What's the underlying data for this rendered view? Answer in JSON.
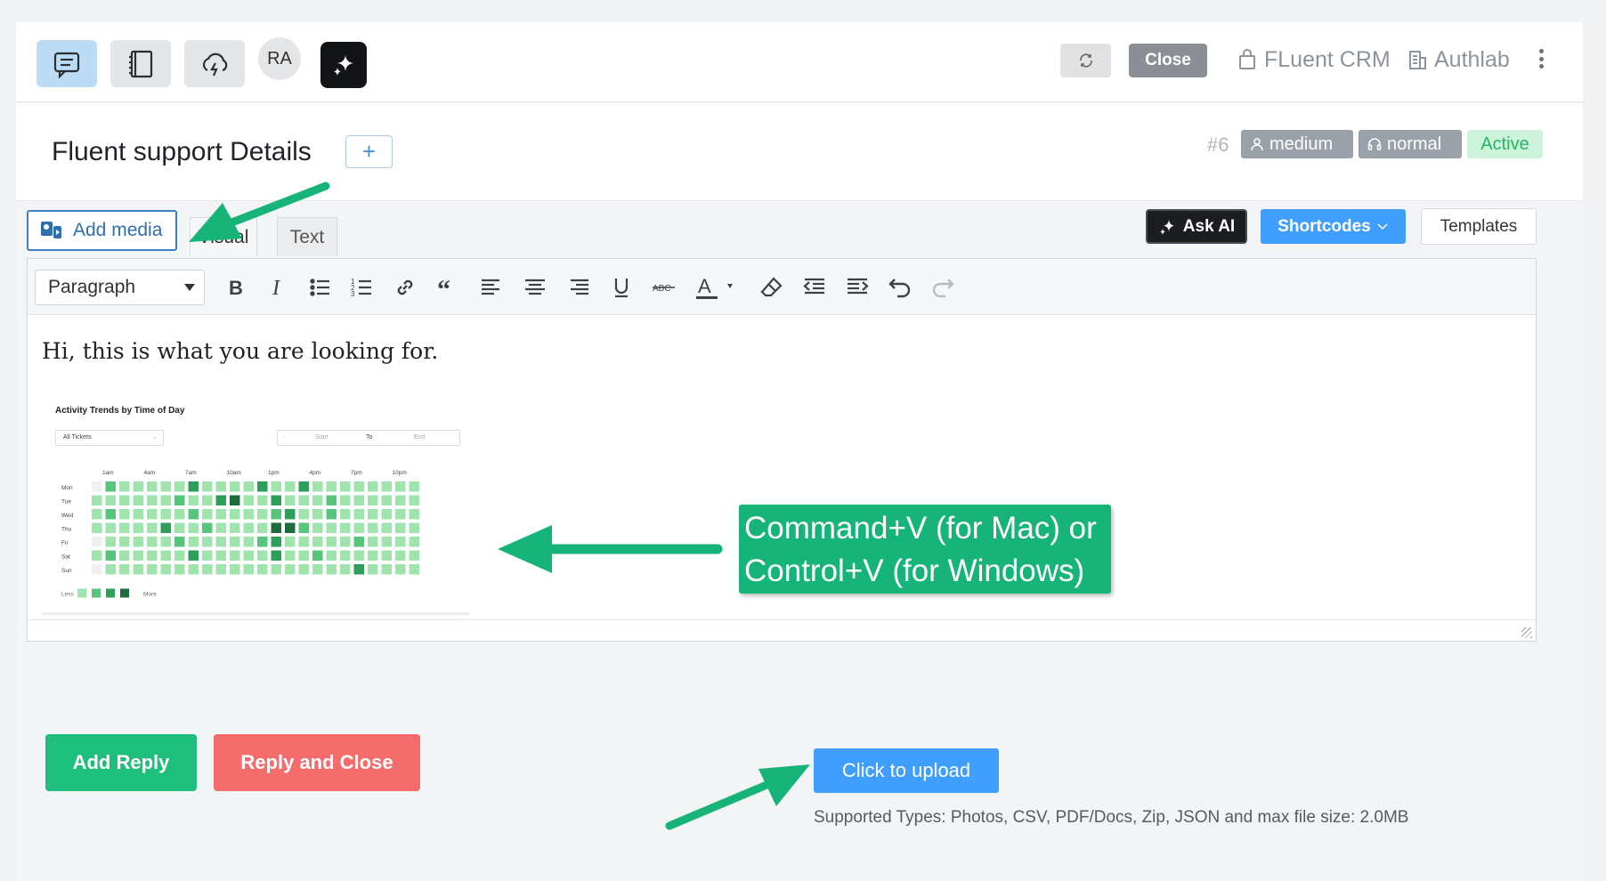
{
  "topbar": {
    "avatar_initials": "RA",
    "close_label": "Close",
    "crm_label": "FLuent CRM",
    "auth_label": "Authlab"
  },
  "header": {
    "title": "Fluent support Details",
    "add_label": "+",
    "ticket_id": "#6",
    "priority_badge": "medium",
    "client_priority_badge": "normal",
    "status_badge": "Active"
  },
  "editor": {
    "add_media_label": "Add media",
    "tab_visual": "Visual",
    "tab_text": "Text",
    "ask_ai_label": "Ask AI",
    "shortcodes_label": "Shortcodes",
    "templates_label": "Templates",
    "format_select": "Paragraph",
    "toolbar_icons": [
      "bold-icon",
      "italic-icon",
      "bullet-list-icon",
      "numbered-list-icon",
      "link-icon",
      "blockquote-icon",
      "align-left-icon",
      "align-center-icon",
      "align-right-icon",
      "underline-icon",
      "strikethrough-icon",
      "text-color-icon",
      "clear-formatting-icon",
      "outdent-icon",
      "indent-icon",
      "undo-icon",
      "redo-icon"
    ],
    "content_text": "Hi, this is what you are looking for."
  },
  "pasted_image": {
    "title": "Activity Trends by Time of Day",
    "filter_value": "All Tickets",
    "date_start": "Start",
    "date_to": "To",
    "date_end": "End",
    "hour_labels": [
      "1am",
      "4am",
      "7am",
      "10am",
      "1pm",
      "4pm",
      "7pm",
      "10pm"
    ],
    "day_labels": [
      "Mon",
      "Tue",
      "Wed",
      "Thu",
      "Fri",
      "Sat",
      "Sun"
    ],
    "legend_less": "Less",
    "legend_more": "More",
    "heat_levels": [
      [
        0,
        2,
        1,
        1,
        1,
        1,
        1,
        3,
        1,
        1,
        1,
        1,
        3,
        1,
        1,
        3,
        1,
        1,
        1,
        1,
        1,
        1,
        1,
        1
      ],
      [
        1,
        1,
        1,
        1,
        1,
        1,
        2,
        1,
        1,
        3,
        4,
        1,
        1,
        3,
        1,
        1,
        1,
        2,
        1,
        1,
        1,
        1,
        1,
        1
      ],
      [
        1,
        2,
        1,
        1,
        1,
        1,
        1,
        2,
        1,
        1,
        1,
        1,
        1,
        2,
        3,
        1,
        1,
        2,
        1,
        1,
        1,
        1,
        1,
        1
      ],
      [
        1,
        1,
        1,
        1,
        1,
        3,
        1,
        1,
        2,
        1,
        1,
        1,
        1,
        4,
        4,
        2,
        1,
        1,
        1,
        1,
        1,
        1,
        1,
        1
      ],
      [
        0,
        1,
        1,
        1,
        1,
        1,
        2,
        1,
        1,
        1,
        1,
        1,
        2,
        3,
        1,
        1,
        1,
        1,
        1,
        2,
        1,
        1,
        1,
        1
      ],
      [
        1,
        2,
        1,
        1,
        1,
        1,
        1,
        3,
        1,
        1,
        1,
        1,
        1,
        3,
        1,
        1,
        2,
        1,
        1,
        1,
        1,
        1,
        1,
        1
      ],
      [
        0,
        1,
        1,
        1,
        1,
        1,
        1,
        1,
        1,
        1,
        1,
        1,
        1,
        1,
        1,
        1,
        1,
        1,
        1,
        3,
        1,
        1,
        1,
        1
      ]
    ],
    "colors": [
      "#eef0f2",
      "#9fe3ad",
      "#57c57b",
      "#2e9e5b",
      "#1f6b3e"
    ]
  },
  "callout": {
    "line1": "Command+V (for Mac) or",
    "line2": "Control+V (for Windows)"
  },
  "footer": {
    "add_reply_label": "Add Reply",
    "reply_close_label": "Reply and Close",
    "upload_label": "Click to upload",
    "upload_hint": "Supported Types: Photos, CSV, PDF/Docs, Zip, JSON and max file size: 2.0MB"
  }
}
